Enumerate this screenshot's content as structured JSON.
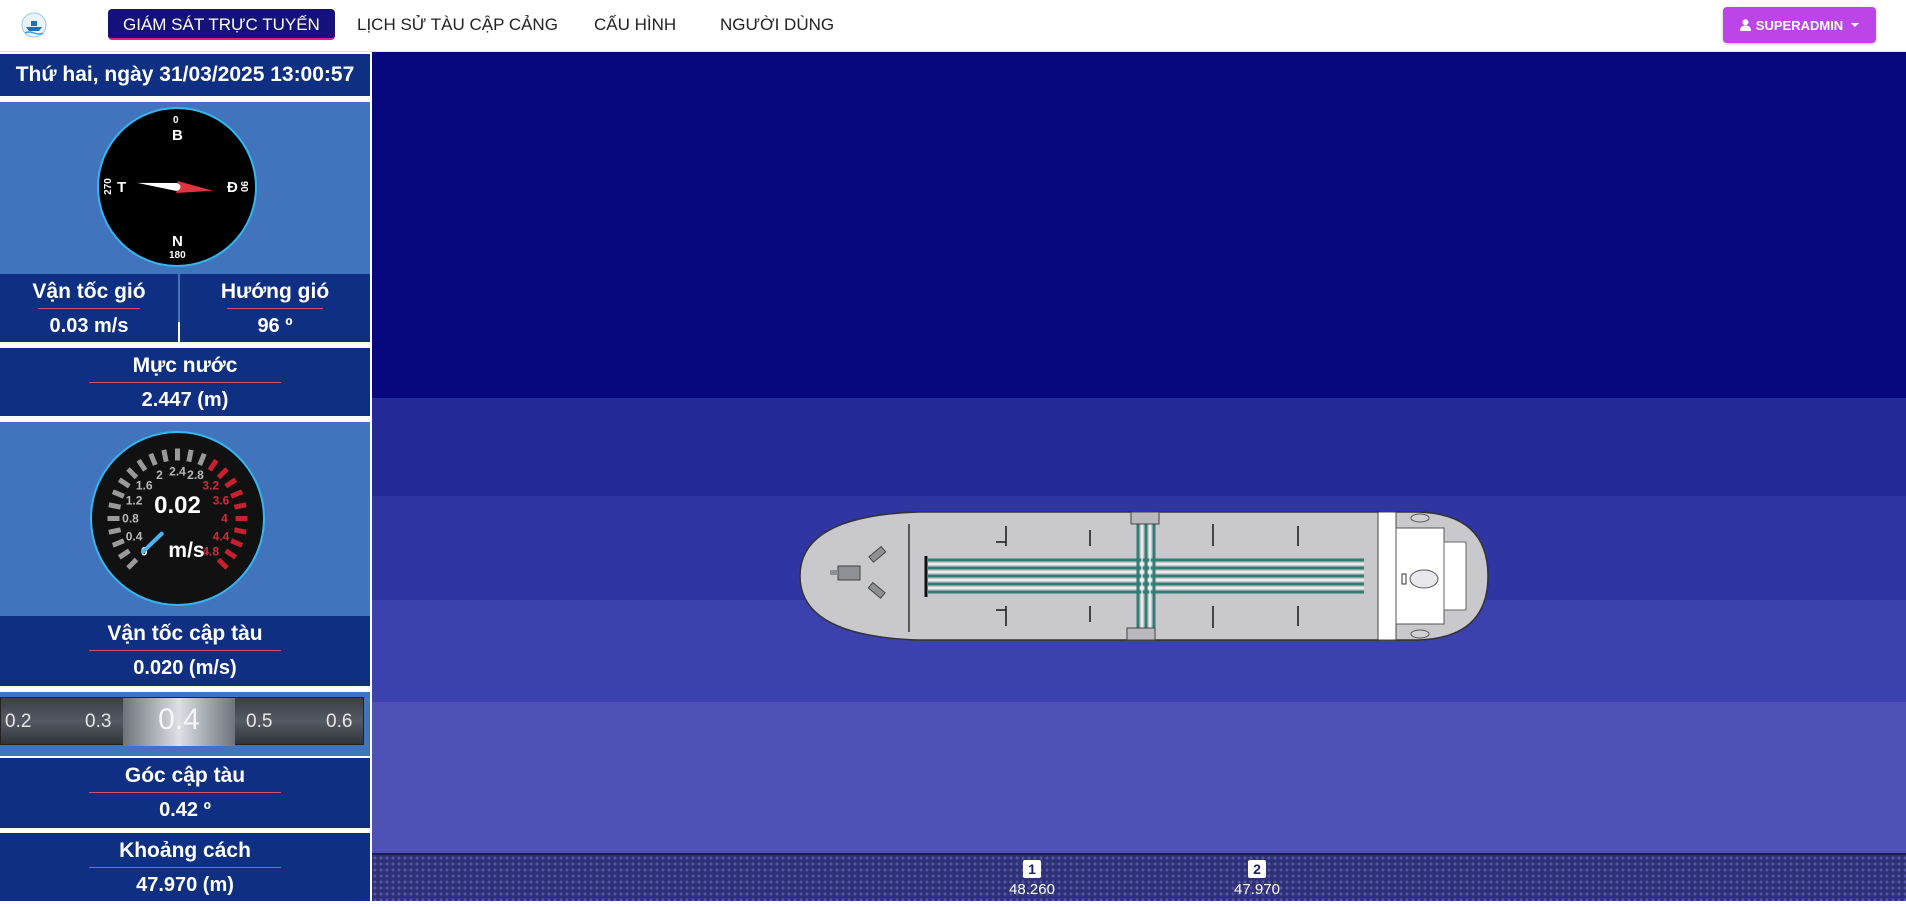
{
  "nav": {
    "items": [
      {
        "label": "GIÁM SÁT TRỰC TUYẾN",
        "active": true
      },
      {
        "label": "LỊCH SỬ TÀU CẬP CẢNG",
        "active": false
      },
      {
        "label": "CẤU HÌNH",
        "active": false
      },
      {
        "label": "NGƯỜI DÙNG",
        "active": false
      }
    ],
    "user_label": "SUPERADMIN",
    "logo_icon": "ship-logo-icon",
    "user_icon": "user-icon",
    "active_color": "#15117a",
    "user_color": "#bd45e8"
  },
  "datetime": "Thứ hai, ngày 31/03/2025 13:00:57",
  "compass": {
    "north": "B",
    "east": "Đ",
    "south": "N",
    "west": "T",
    "deg_north": "0",
    "deg_east": "90",
    "deg_south": "180",
    "deg_west": "270",
    "direction_deg": 96
  },
  "wind": {
    "speed_label": "Vận tốc gió",
    "speed_value": "0.03 m/s",
    "direction_label": "Hướng gió",
    "direction_value": "96 º"
  },
  "water_level": {
    "label": "Mực nước",
    "value": "2.447 (m)"
  },
  "speedometer": {
    "value": "0.02",
    "unit": "m/s",
    "ticks": [
      "0",
      "0.4",
      "0.8",
      "1.2",
      "1.6",
      "2",
      "2.4",
      "2.8",
      "3.2",
      "3.6",
      "4",
      "4.4",
      "4.8"
    ],
    "max": 4.8,
    "reading": 0.02
  },
  "berthing_speed": {
    "label": "Vận tốc cập tàu",
    "value": "0.020 (m/s)"
  },
  "angle_tape": {
    "ticks": [
      "0.2",
      "0.3",
      "0.4",
      "0.5",
      "0.6"
    ]
  },
  "berthing_angle": {
    "label": "Góc cập tàu",
    "value": "0.42 º"
  },
  "distance": {
    "label": "Khoảng cách",
    "value": "47.970 (m)"
  },
  "sensors": [
    {
      "id": "1",
      "value": "48.260"
    },
    {
      "id": "2",
      "value": "47.970"
    }
  ]
}
